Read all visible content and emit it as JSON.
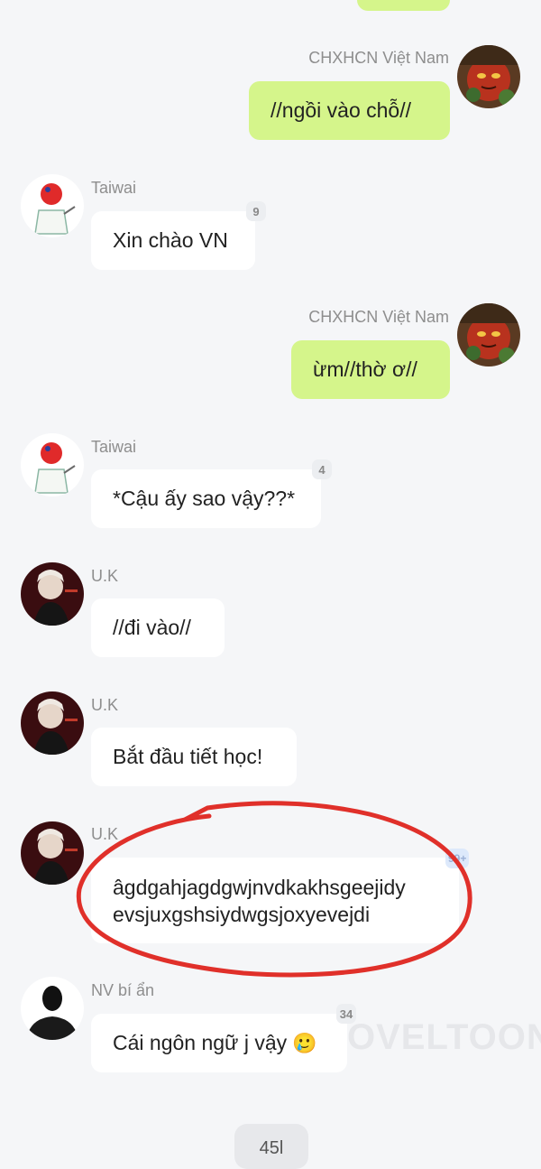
{
  "messages": [
    {
      "sender": "CHXHCN Việt Nam",
      "text": "//ngồi vào chỗ//",
      "side": "right"
    },
    {
      "sender": "Taiwai",
      "text": "Xin chào VN",
      "side": "left",
      "badge": "9"
    },
    {
      "sender": "CHXHCN Việt Nam",
      "text": "ừm//thờ ơ//",
      "side": "right"
    },
    {
      "sender": "Taiwai",
      "text": "*Cậu ấy sao vậy??*",
      "side": "left",
      "badge": "4"
    },
    {
      "sender": "U.K",
      "text": "//đi vào//",
      "side": "left"
    },
    {
      "sender": "U.K",
      "text": "Bắt đầu tiết học!",
      "side": "left"
    },
    {
      "sender": "U.K",
      "text_line1": "âgdgahjagdgwjnvdkakhsgeejidy",
      "text_line2": "evsjuxgshsiydwgsjoxyevejdi",
      "side": "left",
      "badge": "99+"
    },
    {
      "sender": "NV bí ẩn",
      "text": "Cái ngôn ngữ j vậy",
      "side": "left",
      "badge": "34",
      "emoji": "🥲"
    }
  ],
  "bottom_pill": "45l",
  "watermark": "OVELTOON",
  "colors": {
    "my_bubble": "#d5f58b",
    "their_bubble": "#ffffff",
    "background": "#f5f6f8",
    "annotation": "#e0302a"
  }
}
